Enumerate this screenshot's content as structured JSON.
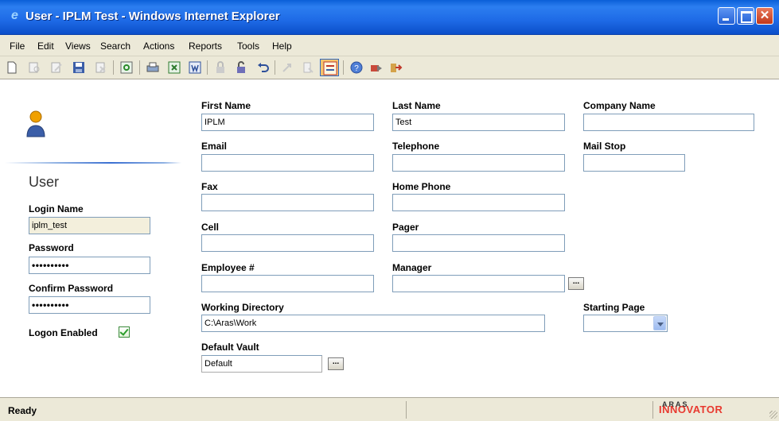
{
  "window": {
    "title": "User - IPLM Test - Windows Internet Explorer"
  },
  "menu": [
    "File",
    "Edit",
    "Views",
    "Search",
    "Actions",
    "Reports",
    "Tools",
    "Help"
  ],
  "toolbar": {
    "icons": [
      "new-icon",
      "view-icon",
      "edit-icon",
      "save-icon",
      "delete-icon",
      "refresh-icon",
      "print-icon",
      "export-excel-icon",
      "export-word-icon",
      "lock-icon",
      "unlock-icon",
      "undo-icon",
      "promote-icon",
      "version-icon",
      "show-form-icon",
      "help-icon",
      "send-icon",
      "logout-icon"
    ]
  },
  "left": {
    "section_title": "User",
    "login_name_label": "Login Name",
    "login_name_value": "iplm_test",
    "password_label": "Password",
    "password_value": "••••••••••",
    "confirm_password_label": "Confirm Password",
    "confirm_password_value": "••••••••••",
    "logon_enabled_label": "Logon Enabled"
  },
  "form": {
    "first_name_label": "First Name",
    "first_name_value": "IPLM",
    "last_name_label": "Last Name",
    "last_name_value": "Test",
    "company_name_label": "Company Name",
    "company_name_value": "",
    "email_label": "Email",
    "email_value": "",
    "telephone_label": "Telephone",
    "telephone_value": "",
    "mail_stop_label": "Mail Stop",
    "mail_stop_value": "",
    "fax_label": "Fax",
    "fax_value": "",
    "home_phone_label": "Home Phone",
    "home_phone_value": "",
    "cell_label": "Cell",
    "cell_value": "",
    "pager_label": "Pager",
    "pager_value": "",
    "employee_label": "Employee #",
    "employee_value": "",
    "manager_label": "Manager",
    "manager_value": "",
    "working_directory_label": "Working Directory",
    "working_directory_value": "C:\\Aras\\Work",
    "starting_page_label": "Starting Page",
    "starting_page_value": "",
    "default_vault_label": "Default Vault",
    "default_vault_value": "Default",
    "ellipsis": "..."
  },
  "status": {
    "text": "Ready",
    "logo_small": "ARAS",
    "logo_main": "INNOVATOR"
  },
  "colors": {
    "titlebar": "#1e6ae6",
    "chrome": "#ece9d8",
    "field_border": "#7f9db9",
    "readonly_bg": "#f3efdc"
  }
}
